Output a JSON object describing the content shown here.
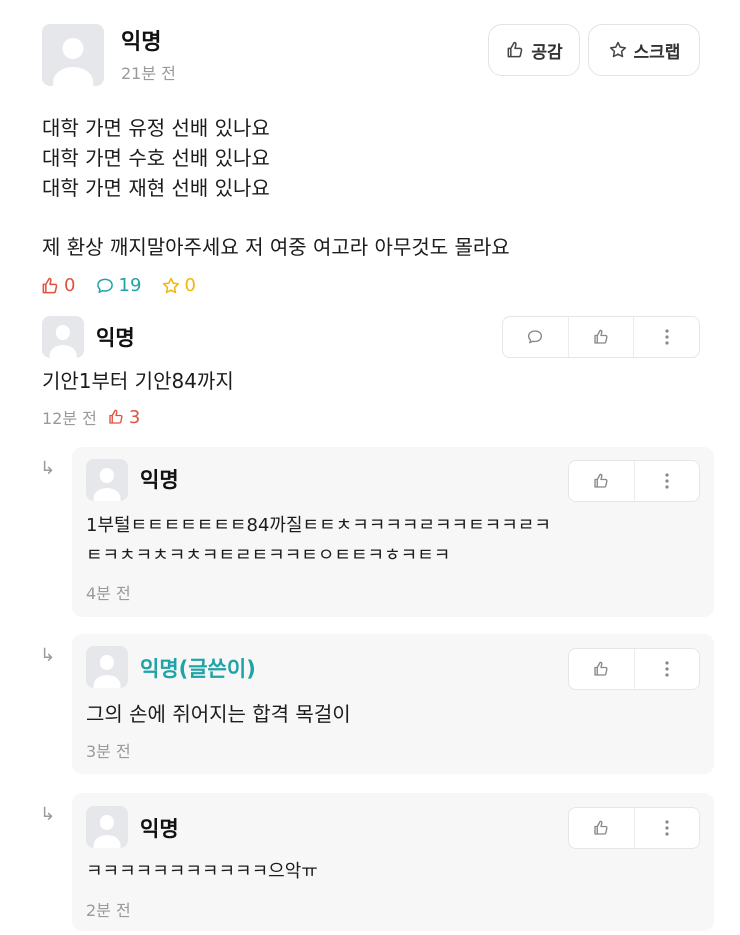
{
  "post": {
    "author": "익명",
    "time": "21분 전",
    "like_button": "공감",
    "scrap_button": "스크랩",
    "lines": [
      "대학 가면 유정 선배 있나요",
      "대학 가면 수호 선배 있나요",
      "대학 가면 재현 선배 있나요"
    ],
    "line4": "제 환상 깨지말아주세요 저 여중 여고라 아무것도 몰라요",
    "likes": "0",
    "comments": "19",
    "scraps": "0",
    "colors": {
      "like": "#e0523f",
      "comment": "#1fa3a6",
      "scrap": "#f2b705"
    }
  },
  "comment": {
    "author": "익명",
    "text": "기안1부터 기안84까지",
    "time": "12분 전",
    "likes": "3"
  },
  "replies": [
    {
      "author": "익명",
      "line1": "1부털ㅌㅌㅌㅌㅌㅌㅌ84까질ㅌㅌㅊㅋㅋㅋㅋㄹㅋㅋㅌㅋㅋㄹㅋ",
      "line2": "ㅌㅋㅊㅋㅊㅋㅊㅋㅌㄹㅌㅋㅋㅌㅇㅌㅌㅋㅎㅋㅌㅋ",
      "time": "4분 전"
    },
    {
      "author": "익명(글쓴이)",
      "line1": "그의 손에 쥐어지는 합격 목걸이",
      "time": "3분 전"
    },
    {
      "author": "익명",
      "line1": "ㅋㅋㅋㅋㅋㅋㅋㅋㅋㅋㅋ으악ㅠ",
      "time": "2분 전"
    }
  ]
}
